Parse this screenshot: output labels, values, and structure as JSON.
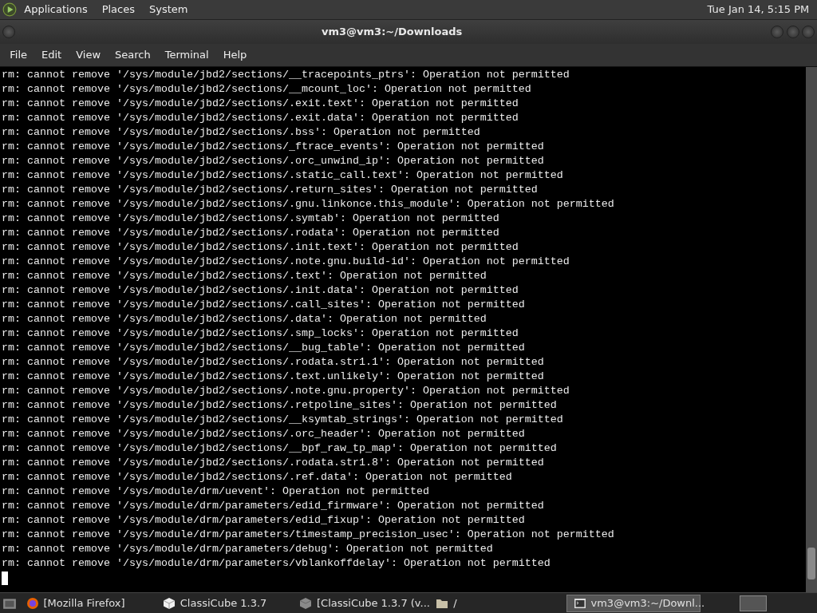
{
  "top_panel": {
    "menus": [
      "Applications",
      "Places",
      "System"
    ],
    "clock": "Tue Jan 14,  5:15 PM"
  },
  "window": {
    "title": "vm3@vm3:~/Downloads"
  },
  "menubar": [
    "File",
    "Edit",
    "View",
    "Search",
    "Terminal",
    "Help"
  ],
  "terminal": {
    "lines": [
      "rm: cannot remove '/sys/module/jbd2/sections/__tracepoints_ptrs': Operation not permitted",
      "rm: cannot remove '/sys/module/jbd2/sections/__mcount_loc': Operation not permitted",
      "rm: cannot remove '/sys/module/jbd2/sections/.exit.text': Operation not permitted",
      "rm: cannot remove '/sys/module/jbd2/sections/.exit.data': Operation not permitted",
      "rm: cannot remove '/sys/module/jbd2/sections/.bss': Operation not permitted",
      "rm: cannot remove '/sys/module/jbd2/sections/_ftrace_events': Operation not permitted",
      "rm: cannot remove '/sys/module/jbd2/sections/.orc_unwind_ip': Operation not permitted",
      "rm: cannot remove '/sys/module/jbd2/sections/.static_call.text': Operation not permitted",
      "rm: cannot remove '/sys/module/jbd2/sections/.return_sites': Operation not permitted",
      "rm: cannot remove '/sys/module/jbd2/sections/.gnu.linkonce.this_module': Operation not permitted",
      "rm: cannot remove '/sys/module/jbd2/sections/.symtab': Operation not permitted",
      "rm: cannot remove '/sys/module/jbd2/sections/.rodata': Operation not permitted",
      "rm: cannot remove '/sys/module/jbd2/sections/.init.text': Operation not permitted",
      "rm: cannot remove '/sys/module/jbd2/sections/.note.gnu.build-id': Operation not permitted",
      "rm: cannot remove '/sys/module/jbd2/sections/.text': Operation not permitted",
      "rm: cannot remove '/sys/module/jbd2/sections/.init.data': Operation not permitted",
      "rm: cannot remove '/sys/module/jbd2/sections/.call_sites': Operation not permitted",
      "rm: cannot remove '/sys/module/jbd2/sections/.data': Operation not permitted",
      "rm: cannot remove '/sys/module/jbd2/sections/.smp_locks': Operation not permitted",
      "rm: cannot remove '/sys/module/jbd2/sections/__bug_table': Operation not permitted",
      "rm: cannot remove '/sys/module/jbd2/sections/.rodata.str1.1': Operation not permitted",
      "rm: cannot remove '/sys/module/jbd2/sections/.text.unlikely': Operation not permitted",
      "rm: cannot remove '/sys/module/jbd2/sections/.note.gnu.property': Operation not permitted",
      "rm: cannot remove '/sys/module/jbd2/sections/.retpoline_sites': Operation not permitted",
      "rm: cannot remove '/sys/module/jbd2/sections/__ksymtab_strings': Operation not permitted",
      "rm: cannot remove '/sys/module/jbd2/sections/.orc_header': Operation not permitted",
      "rm: cannot remove '/sys/module/jbd2/sections/__bpf_raw_tp_map': Operation not permitted",
      "rm: cannot remove '/sys/module/jbd2/sections/.rodata.str1.8': Operation not permitted",
      "rm: cannot remove '/sys/module/jbd2/sections/.ref.data': Operation not permitted",
      "rm: cannot remove '/sys/module/drm/uevent': Operation not permitted",
      "rm: cannot remove '/sys/module/drm/parameters/edid_firmware': Operation not permitted",
      "rm: cannot remove '/sys/module/drm/parameters/edid_fixup': Operation not permitted",
      "rm: cannot remove '/sys/module/drm/parameters/timestamp_precision_usec': Operation not permitted",
      "rm: cannot remove '/sys/module/drm/parameters/debug': Operation not permitted",
      "rm: cannot remove '/sys/module/drm/parameters/vblankoffdelay': Operation not permitted"
    ]
  },
  "taskbar": [
    {
      "kind": "browser",
      "label": "[Mozilla Firefox]",
      "selected": false
    },
    {
      "kind": "cube",
      "label": "ClassiCube 1.3.7",
      "selected": false
    },
    {
      "kind": "cube-grey",
      "label": "[ClassiCube 1.3.7 (v...",
      "selected": false
    },
    {
      "kind": "folder",
      "label": "/",
      "selected": false
    },
    {
      "kind": "terminal",
      "label": "vm3@vm3:~/Downl...",
      "selected": true
    }
  ]
}
